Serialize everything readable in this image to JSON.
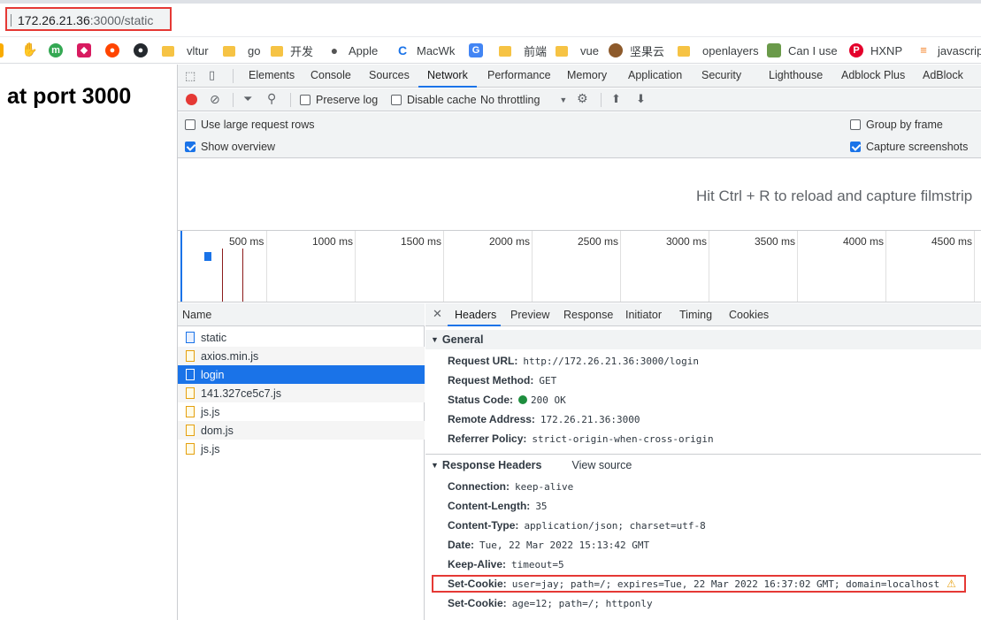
{
  "address_bar": {
    "host": "172.26.21.36",
    "rest": ":3000/static"
  },
  "bookmarks": [
    {
      "label": "",
      "icon": "hand-icon",
      "color": "#1a73e8"
    },
    {
      "label": "",
      "icon": "m-icon",
      "color": "#34a853"
    },
    {
      "label": "",
      "icon": "pink-app-icon",
      "color": "#d81b60"
    },
    {
      "label": "",
      "icon": "reddit-icon",
      "color": "#ff4500"
    },
    {
      "label": "",
      "icon": "github-icon",
      "color": "#24292e"
    },
    {
      "label": "vltur",
      "icon": "folder-icon"
    },
    {
      "label": "go",
      "icon": "folder-icon"
    },
    {
      "label": "开发",
      "icon": "folder-icon"
    },
    {
      "label": "Apple",
      "icon": "apple-icon"
    },
    {
      "label": "MacWk",
      "icon": "macwk-icon"
    },
    {
      "label": "",
      "icon": "translate-icon"
    },
    {
      "label": "前端",
      "icon": "folder-icon"
    },
    {
      "label": "vue",
      "icon": "folder-icon"
    },
    {
      "label": "坚果云",
      "icon": "nut-icon"
    },
    {
      "label": "openlayers",
      "icon": "folder-icon"
    },
    {
      "label": "Can I use",
      "icon": "caniuse-icon"
    },
    {
      "label": "HXNP",
      "icon": "p-icon"
    },
    {
      "label": "javascrip",
      "icon": "stackoverflow-icon"
    }
  ],
  "page": {
    "heading": "at port 3000"
  },
  "devtools": {
    "tabs": [
      "Elements",
      "Console",
      "Sources",
      "Network",
      "Performance",
      "Memory",
      "Application",
      "Security",
      "Lighthouse",
      "Adblock Plus",
      "AdBlock"
    ],
    "active_tab": "Network",
    "toolbar": {
      "preserve_log": "Preserve log",
      "disable_cache": "Disable cache",
      "throttling": "No throttling"
    },
    "settings": {
      "large_rows": "Use large request rows",
      "show_overview": "Show overview",
      "group_by_frame": "Group by frame",
      "capture_screenshots": "Capture screenshots"
    },
    "filmstrip_message": "Hit Ctrl + R to reload and capture filmstrip",
    "timeline_ticks": [
      "500 ms",
      "1000 ms",
      "1500 ms",
      "2000 ms",
      "2500 ms",
      "3000 ms",
      "3500 ms",
      "4000 ms",
      "4500 ms"
    ],
    "request_list": {
      "header": "Name",
      "rows": [
        "static",
        "axios.min.js",
        "login",
        "141.327ce5c7.js",
        "js.js",
        "dom.js",
        "js.js"
      ],
      "selected": "login"
    },
    "details": {
      "tabs": [
        "Headers",
        "Preview",
        "Response",
        "Initiator",
        "Timing",
        "Cookies"
      ],
      "active_tab": "Headers",
      "general_title": "General",
      "general": [
        {
          "name": "Request URL:",
          "value": "http://172.26.21.36:3000/login"
        },
        {
          "name": "Request Method:",
          "value": "GET"
        },
        {
          "name": "Status Code:",
          "value": "200 OK"
        },
        {
          "name": "Remote Address:",
          "value": "172.26.21.36:3000"
        },
        {
          "name": "Referrer Policy:",
          "value": "strict-origin-when-cross-origin"
        }
      ],
      "response_title": "Response Headers",
      "view_source": "View source",
      "response": [
        {
          "name": "Connection:",
          "value": "keep-alive"
        },
        {
          "name": "Content-Length:",
          "value": "35"
        },
        {
          "name": "Content-Type:",
          "value": "application/json; charset=utf-8"
        },
        {
          "name": "Date:",
          "value": "Tue, 22 Mar 2022 15:13:42 GMT"
        },
        {
          "name": "Keep-Alive:",
          "value": "timeout=5"
        },
        {
          "name": "Set-Cookie:",
          "value": "user=jay; path=/; expires=Tue, 22 Mar 2022 16:37:02 GMT; domain=localhost"
        },
        {
          "name": "Set-Cookie:",
          "value": "age=12; path=/; httponly"
        }
      ]
    }
  }
}
